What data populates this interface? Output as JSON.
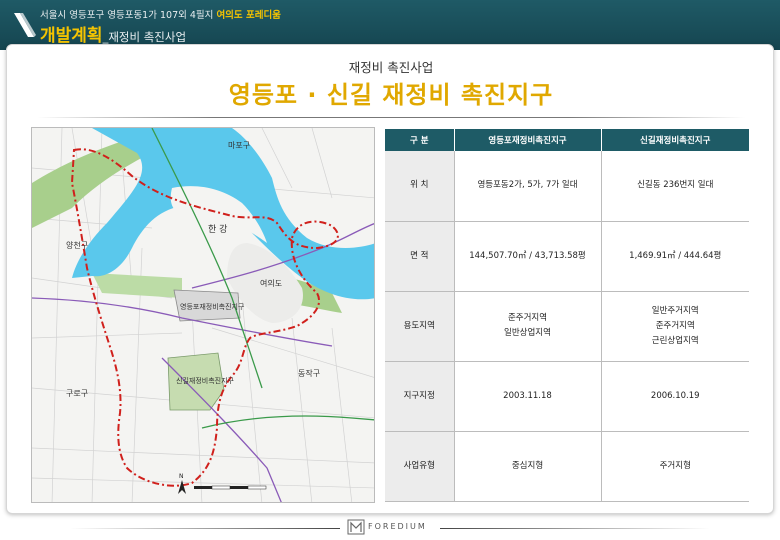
{
  "header": {
    "address": "서울시 영등포구 영등포동1가 107외 4필지",
    "project_name": "여의도 포레디움",
    "section_main": "개발계획",
    "section_sub": "_재정비 촉진사업"
  },
  "content": {
    "subtitle": "재정비 촉진사업",
    "title": "영등포 · 신길 재정비 촉진지구"
  },
  "map": {
    "labels": {
      "mapo": "마포구",
      "han_river": "한 강",
      "yangcheon": "양천구",
      "yeouido": "여의도",
      "yeongdeungpo_zone": "영등포재정비촉진지구",
      "singil_zone": "신길재정비촉진지구",
      "guro": "구로구",
      "dongjak": "동작구",
      "north": "N"
    },
    "colors": {
      "river": "#5ac8ec",
      "park": "#a8cf8c",
      "zone_fill": "#c6dcb0",
      "boundary": "#d0201c",
      "road_purple": "#8a5bb8",
      "road_green": "#3a9a4a"
    }
  },
  "table": {
    "headers": [
      "구   분",
      "영등포재정비촉진지구",
      "신길재정비촉진지구"
    ],
    "rows": [
      {
        "label": "위       치",
        "a": [
          "영등포동2가, 5가, 7가 일대"
        ],
        "b": [
          "신길동 236번지 일대"
        ]
      },
      {
        "label": "면       적",
        "a": [
          "144,507.70㎡ / 43,713.58평"
        ],
        "b": [
          "1,469.91㎡ / 444.64평"
        ]
      },
      {
        "label": "용도지역",
        "a": [
          "준주거지역",
          "일반상업지역"
        ],
        "b": [
          "일반주거지역",
          "준주거지역",
          "근린상업지역"
        ]
      },
      {
        "label": "지구지정",
        "a": [
          "2003.11.18"
        ],
        "b": [
          "2006.10.19"
        ]
      },
      {
        "label": "사업유형",
        "a": [
          "중심지형"
        ],
        "b": [
          "주거지형"
        ]
      }
    ]
  },
  "footer": {
    "brand": "FOREDIUM"
  }
}
